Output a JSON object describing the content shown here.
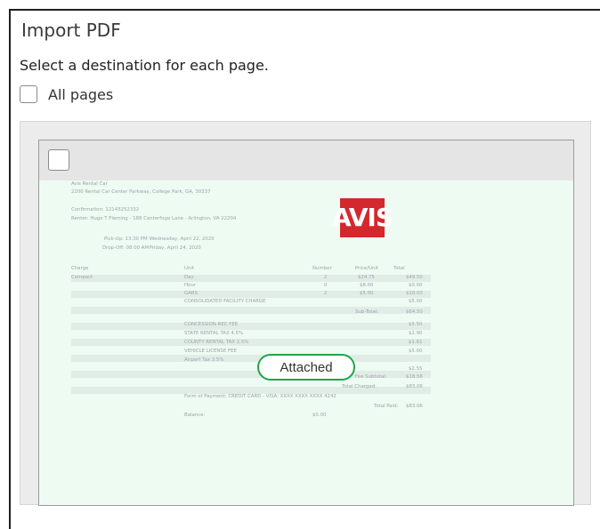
{
  "dialog": {
    "title": "Import PDF",
    "subtitle": "Select a destination for each page.",
    "all_pages_label": "All pages"
  },
  "page": {
    "status_badge": "Attached",
    "receipt": {
      "company": "Avis Rental Car",
      "address": "2200 Rental Car Center Parkway, College Park, GA, 30337",
      "confirmation": "Confirmation: 12143252332",
      "renter": "Renter: Hugo T Fleming - 188 Centerfuge Lane - Arlington, VA 22204",
      "pickup_label": "Pick-Up: 13:30 PM -",
      "pickup_date": "Wednesday, April 22, 2020",
      "dropoff_label": "Drop-Off: 08:00 AM -",
      "dropoff_date": "Friday, April 24, 2020",
      "logo_text": "AVIS",
      "headers": {
        "charge": "Charge",
        "unit": "Unit",
        "number": "Number",
        "price": "Price/Unit",
        "total": "Total"
      },
      "rows": [
        {
          "charge": "Compact",
          "unit": "Day",
          "number": "2",
          "price": "$24.75",
          "total": "$49.50"
        },
        {
          "charge": "",
          "unit": "Hour",
          "number": "0",
          "price": "$8.00",
          "total": "$0.00"
        },
        {
          "charge": "",
          "unit": "GARS",
          "number": "2",
          "price": "$5.00",
          "total": "$10.00"
        },
        {
          "charge": "",
          "unit": "CONSOLIDATED FACILITY CHARGE",
          "number": "",
          "price": "",
          "total": "$5.00"
        },
        {
          "charge": "",
          "unit": "",
          "number": "",
          "price": "Sub-Total:",
          "total": "$64.50"
        },
        {
          "charge": "",
          "unit": "CONCESSION REC FEE",
          "number": "",
          "price": "",
          "total": "$5.50"
        },
        {
          "charge": "",
          "unit": "STATE RENTAL TAX 4.5%",
          "number": "",
          "price": "",
          "total": "$2.90"
        },
        {
          "charge": "",
          "unit": "COUNTY RENTAL TAX 2.5%",
          "number": "",
          "price": "",
          "total": "$1.61"
        },
        {
          "charge": "",
          "unit": "VEHICLE LICENSE FEE",
          "number": "",
          "price": "",
          "total": "$5.00"
        },
        {
          "charge": "",
          "unit": "Airport Tax 3.5%",
          "number": "",
          "price": "",
          "total": "$2.55"
        }
      ],
      "fee_subtotal_label": "Fee Subtotal:",
      "fee_subtotal": "$18.56",
      "total_charged_label": "Total Charged:",
      "total_charged": "$83.06",
      "payment": "Form of Payment: CREDIT CARD - VISA: XXXX XXXX XXXX 4242",
      "total_paid_label": "Total Paid:",
      "total_paid": "$83.06",
      "balance_label": "Balance:",
      "balance": "$0.00"
    }
  }
}
